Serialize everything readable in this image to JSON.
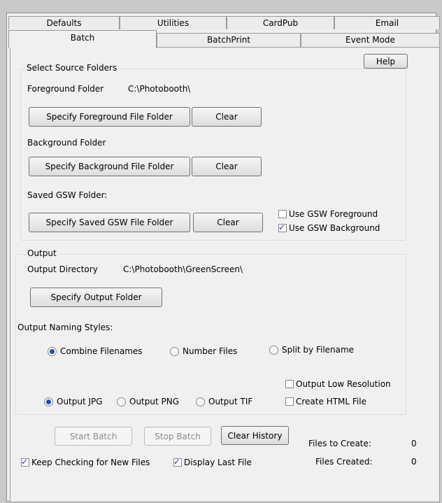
{
  "tabs": {
    "row_back": [
      {
        "label": "Defaults"
      },
      {
        "label": "Utilities"
      },
      {
        "label": "CardPub"
      },
      {
        "label": "Email"
      }
    ],
    "row_front": [
      {
        "label": "Batch",
        "active": true
      },
      {
        "label": "BatchPrint"
      },
      {
        "label": "Event Mode"
      }
    ]
  },
  "help_label": "Help",
  "source": {
    "title": "Select Source Folders",
    "foreground_label": "Foreground Folder",
    "foreground_path": "C:\\Photobooth\\",
    "specify_foreground_label": "Specify Foreground File Folder",
    "clear_label": "Clear",
    "background_label": "Background Folder",
    "specify_background_label": "Specify Background File Folder",
    "saved_label": "Saved GSW Folder:",
    "specify_saved_label": "Specify Saved GSW File Folder",
    "use_gsw_foreground": {
      "label": "Use GSW Foreground",
      "checked": false
    },
    "use_gsw_background": {
      "label": "Use GSW Background",
      "checked": true
    }
  },
  "output": {
    "title": "Output",
    "directory_label": "Output Directory",
    "directory_path": "C:\\Photobooth\\GreenScreen\\",
    "specify_output_label": "Specify Output Folder",
    "naming_label": "Output Naming Styles:",
    "naming_options": [
      {
        "label": "Combine Filenames",
        "selected": true
      },
      {
        "label": "Number Files",
        "selected": false
      },
      {
        "label": "Split by Filename",
        "selected": false
      }
    ],
    "format_options": [
      {
        "label": "Output JPG",
        "selected": true
      },
      {
        "label": "Output PNG",
        "selected": false
      },
      {
        "label": "Output TIF",
        "selected": false
      }
    ],
    "output_low_resolution": {
      "label": "Output Low Resolution",
      "checked": false
    },
    "create_html_file": {
      "label": "Create HTML File",
      "checked": false
    }
  },
  "batch": {
    "start_label": "Start Batch",
    "stop_label": "Stop Batch",
    "clear_history_label": "Clear History",
    "keep_checking": {
      "label": "Keep Checking for New Files",
      "checked": true
    },
    "display_last_file": {
      "label": "Display Last File",
      "checked": true
    },
    "files_to_create_label": "Files to Create:",
    "files_to_create_value": "0",
    "files_created_label": "Files Created:",
    "files_created_value": "0"
  }
}
